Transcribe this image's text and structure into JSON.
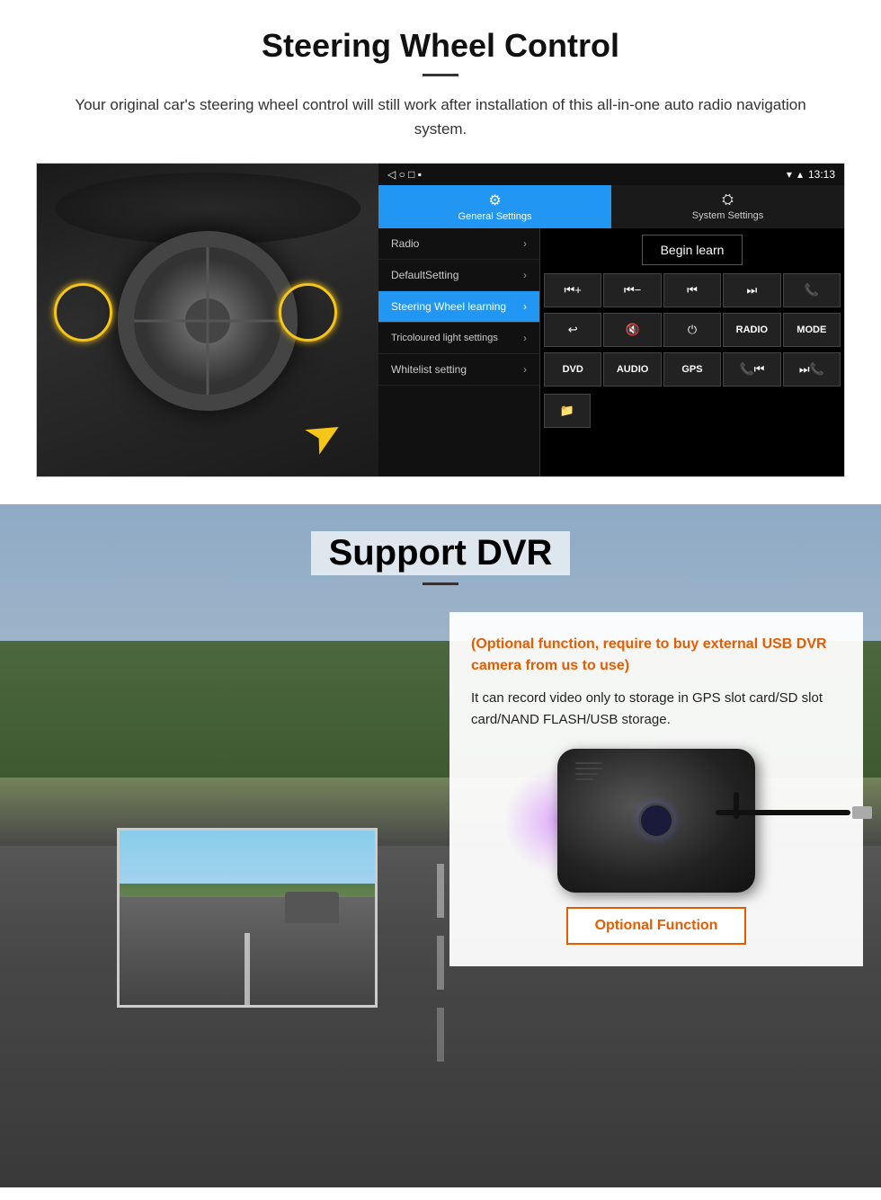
{
  "page": {
    "steering_section": {
      "title": "Steering Wheel Control",
      "subtitle": "Your original car's steering wheel control will still work after installation of this all-in-one auto radio navigation system.",
      "statusbar": {
        "time": "13:13",
        "signal_icon": "▼",
        "wifi_icon": "▲"
      },
      "tabs": [
        {
          "label": "General Settings",
          "icon": "⚙",
          "active": true
        },
        {
          "label": "System Settings",
          "icon": "🔧",
          "active": false
        }
      ],
      "menu_items": [
        {
          "label": "Radio",
          "active": false
        },
        {
          "label": "DefaultSetting",
          "active": false
        },
        {
          "label": "Steering Wheel learning",
          "active": true
        },
        {
          "label": "Tricoloured light settings",
          "active": false
        },
        {
          "label": "Whitelist setting",
          "active": false
        }
      ],
      "begin_learn_label": "Begin learn",
      "control_buttons": [
        [
          "⏮+",
          "⏮-",
          "⏮⏮",
          "⏭⏭",
          "📞"
        ],
        [
          "↩",
          "🔇",
          "⏻",
          "RADIO",
          "MODE"
        ],
        [
          "DVD",
          "AUDIO",
          "GPS",
          "📞⏮",
          "⏭⏭"
        ]
      ]
    },
    "dvr_section": {
      "title": "Support DVR",
      "divider": true,
      "optional_text": "(Optional function, require to buy external USB DVR camera from us to use)",
      "description": "It can record video only to storage in GPS slot card/SD slot card/NAND FLASH/USB storage.",
      "optional_function_label": "Optional Function"
    }
  }
}
